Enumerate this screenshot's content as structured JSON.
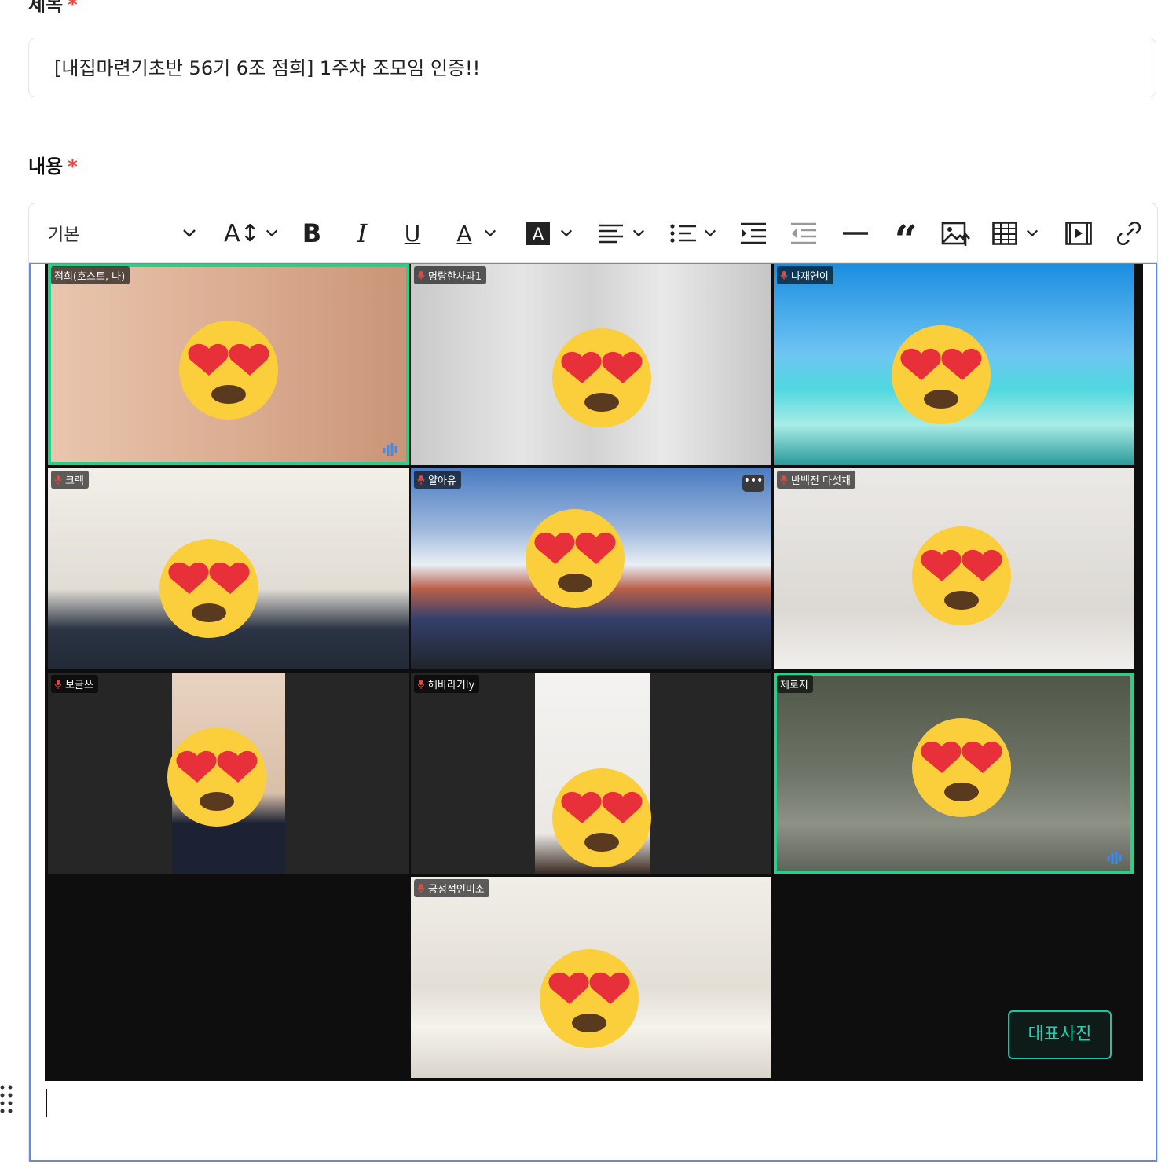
{
  "form": {
    "title_label": "제목",
    "title_value": "[내집마련기초반 56기 6조 점희] 1주차 조모임 인증!!",
    "content_label": "내용",
    "required_mark": "*"
  },
  "toolbar": {
    "style_select": "기본",
    "buttons": [
      "font-size",
      "bold",
      "italic",
      "underline",
      "font-color",
      "highlight",
      "align",
      "bullet-list",
      "indent",
      "outdent",
      "horizontal-rule",
      "quote",
      "image",
      "table",
      "video",
      "link"
    ]
  },
  "zoom": {
    "participants": [
      {
        "name": "점희(호스트, 나)",
        "muted": false,
        "highlight": true,
        "speaking": true
      },
      {
        "name": "명랑한사과1",
        "muted": true
      },
      {
        "name": "나재연이",
        "muted": true
      },
      {
        "name": "크렉",
        "muted": true
      },
      {
        "name": "얄아유",
        "muted": true,
        "more": true
      },
      {
        "name": "반백전 다섯채",
        "muted": true
      },
      {
        "name": "보글쓰",
        "muted": true
      },
      {
        "name": "해바라기ly",
        "muted": true
      },
      {
        "name": "제로지",
        "muted": false,
        "highlight": true,
        "speaking": true
      },
      {
        "name": "긍정적인미소",
        "muted": true
      }
    ],
    "more_icon": "•••",
    "representative_button": "대표사진"
  },
  "colors": {
    "accent": "#5a8dee",
    "required": "#e8453c",
    "zoom_highlight": "#23d18b",
    "rep_button": "#19d4b0"
  }
}
